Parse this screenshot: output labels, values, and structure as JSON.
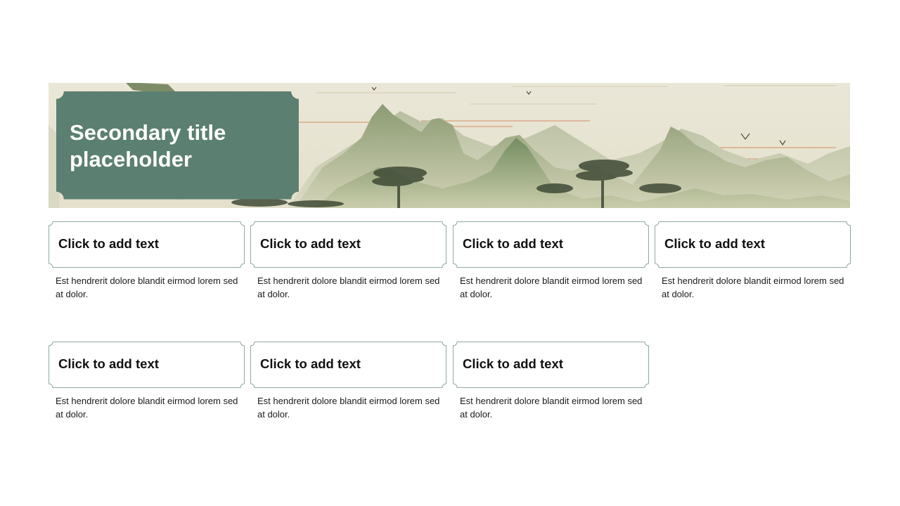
{
  "slide": {
    "title": "Secondary title placeholder",
    "cards": [
      {
        "heading": "Click to add text",
        "body": "Est hendrerit dolore blandit eirmod lorem sed at dolor."
      },
      {
        "heading": "Click to add text",
        "body": "Est hendrerit dolore blandit eirmod lorem sed at dolor."
      },
      {
        "heading": "Click to add text",
        "body": "Est hendrerit dolore blandit eirmod lorem sed at dolor."
      },
      {
        "heading": "Click to add text",
        "body": "Est hendrerit dolore blandit eirmod lorem sed at dolor."
      },
      {
        "heading": "Click to add text",
        "body": "Est hendrerit dolore blandit eirmod lorem sed at dolor."
      },
      {
        "heading": "Click to add text",
        "body": "Est hendrerit dolore blandit eirmod lorem sed at dolor."
      },
      {
        "heading": "Click to add text",
        "body": "Est hendrerit dolore blandit eirmod lorem sed at dolor."
      }
    ]
  },
  "colors": {
    "title_box": "#5b7f70",
    "card_border": "#8fa9a0",
    "banner_sky": "#ebe6d6",
    "mountain": "#7f9168"
  }
}
